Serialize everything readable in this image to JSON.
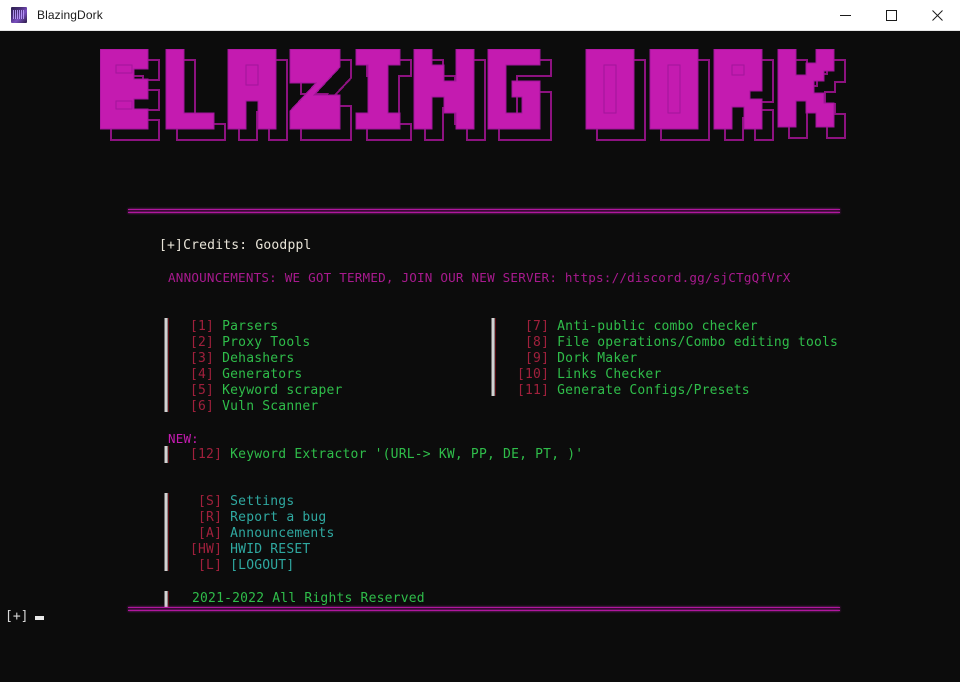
{
  "window": {
    "title": "BlazingDork",
    "icon": "app-icon",
    "controls": {
      "minimize": "minimize-icon",
      "maximize": "maximize-icon",
      "close": "close-icon"
    }
  },
  "logo": {
    "text": "BLAZING DORK",
    "style": "block-ascii-art",
    "fill_color": "#c41bb0",
    "outline_color": "#7a0f6e"
  },
  "divider": {
    "color": "#b0179e"
  },
  "credits": {
    "marker": "[+]",
    "label": "Credits: Goodppl"
  },
  "announcement": {
    "text": "ANNOUNCEMENTS: WE GOT TERMED, JOIN OUR NEW SERVER: https://discord.gg/sjCTgQfVrX",
    "color": "#a81a8e"
  },
  "menu": {
    "left_column": [
      {
        "key": "[1]",
        "label": "Parsers"
      },
      {
        "key": "[2]",
        "label": "Proxy Tools"
      },
      {
        "key": "[3]",
        "label": "Dehashers"
      },
      {
        "key": "[4]",
        "label": "Generators"
      },
      {
        "key": "[5]",
        "label": "Keyword scraper"
      },
      {
        "key": "[6]",
        "label": "Vuln Scanner"
      }
    ],
    "right_column": [
      {
        "key": "[7]",
        "label": "Anti-public combo checker"
      },
      {
        "key": "[8]",
        "label": "File operations/Combo editing tools"
      },
      {
        "key": "[9]",
        "label": "Dork Maker"
      },
      {
        "key": "[10]",
        "label": "Links Checker"
      },
      {
        "key": "[11]",
        "label": "Generate Configs/Presets"
      }
    ],
    "new_section": {
      "header": "NEW:",
      "items": [
        {
          "key": "[12]",
          "label": "Keyword Extractor '(URL-> KW, PP, DE, PT, )'"
        }
      ]
    },
    "bottom_column": [
      {
        "key": "[S]",
        "label": "Settings"
      },
      {
        "key": "[R]",
        "label": "Report a bug"
      },
      {
        "key": "[A]",
        "label": "Announcements"
      },
      {
        "key": "[HW]",
        "label": "HWID RESET"
      },
      {
        "key": "[L]",
        "label": "[LOGOUT]"
      }
    ]
  },
  "copyright": "2021-2022 All Rights Reserved",
  "prompt": {
    "marker": "[+]",
    "value": ""
  },
  "colors": {
    "background": "#0c0c0c",
    "key_red": "#a0203c",
    "menu_green": "#2fbd4a",
    "menu_cyan": "#2fa8a0",
    "accent_magenta": "#c41bb0"
  }
}
